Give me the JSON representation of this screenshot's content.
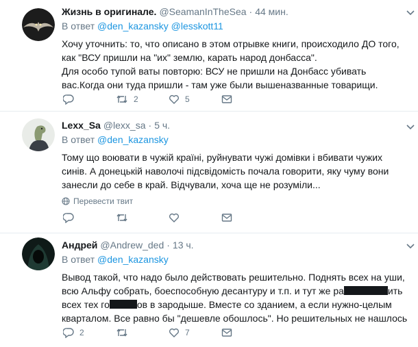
{
  "tweets": [
    {
      "name": "Жизнь в оригинале.",
      "handle": "@SeamanInTheSea",
      "time": "44 мин.",
      "reply_prefix": "В ответ",
      "mentions": [
        "@den_kazansky",
        "@lesskott11"
      ],
      "lines": [
        "Хочу уточнить: то, что описано в этом отрывке книги, происходило ДО того,",
        "как \"ВСУ пришли на \"их\" землю, карать народ донбасса\".",
        "Для особо тупой ваты повторю: ВСУ не пришли на Донбасс убивать",
        "вас.Когда они туда пришли - там уже были вышеназванные товарищи."
      ],
      "replies": "",
      "retweets": "2",
      "likes": "5"
    },
    {
      "name": "Lexx_Sa",
      "handle": "@lexx_sa",
      "time": "5 ч.",
      "reply_prefix": "В ответ",
      "mentions": [
        "@den_kazansky"
      ],
      "lines": [
        "Тому що воювати в чужій країні, руйнувати чужі домівки і вбивати чужих",
        "синів. А донецькій наволочі підсвідомість почала говорити, яку чуму вони",
        "занесли до себе в край. Відчували, хоча ще не розуміли..."
      ],
      "translate_label": "Перевести твит",
      "replies": "",
      "retweets": "",
      "likes": ""
    },
    {
      "name": "Андрей",
      "handle": "@Andrew_ded",
      "time": "13 ч.",
      "reply_prefix": "В ответ",
      "mentions": [
        "@den_kazansky"
      ],
      "line1": "Вывод такой, что надо было действовать решительно. Поднять всех на уши,",
      "line2a": "всю Альфу собрать, боеспособную десантуру и т.п.  и тут же ра",
      "line2b": "ить",
      "line3a": "всех тех го",
      "line3b": "ов в зародыше. Вместе со зданием, а если нужно-целым",
      "line4": "кварталом. Все равно бы \"дешевле обошлось\". Но решительных не нашлось",
      "replies": "2",
      "retweets": "",
      "likes": "7"
    }
  ],
  "icons": {
    "reply": "reply-icon",
    "retweet": "retweet-icon",
    "like": "heart-icon",
    "dm": "envelope-icon",
    "more": "chevron-down-icon",
    "translate": "globe-icon"
  },
  "colors": {
    "link": "#1b95e0",
    "secondary": "#657786",
    "divider": "#e6ecf0"
  }
}
